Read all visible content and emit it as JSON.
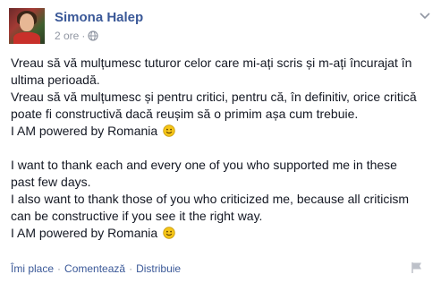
{
  "post": {
    "author": "Simona Halep",
    "time": "2 ore",
    "separator": "·",
    "icons": {
      "privacy": "globe-icon",
      "menu": "chevron-down-icon",
      "emoji": "smile-emoticon",
      "report": "flag-icon"
    },
    "body_ro": [
      "Vreau să vă mulțumesc tuturor celor care mi-ați scris și m-ați încurajat în",
      "ultima perioadă.",
      "Vreau să vă mulțumesc și pentru critici, pentru că, în definitiv, orice critică",
      "poate fi constructivă dacă reușim să o primim așa cum trebuie.",
      "I AM powered by Romania"
    ],
    "body_en": [
      "I want to thank each and every one of you who supported me in these",
      "past few days.",
      "I also want to thank those of you who criticized me, because all criticism",
      "can be constructive if you see it the right way.",
      "I AM powered by Romania"
    ]
  },
  "actions": {
    "like": "Îmi place",
    "comment": "Comentează",
    "share": "Distribuie",
    "separator": "·"
  },
  "colors": {
    "link": "#3b5998",
    "meta": "#9197a3",
    "text": "#141823",
    "emoji": "#f5c518"
  }
}
